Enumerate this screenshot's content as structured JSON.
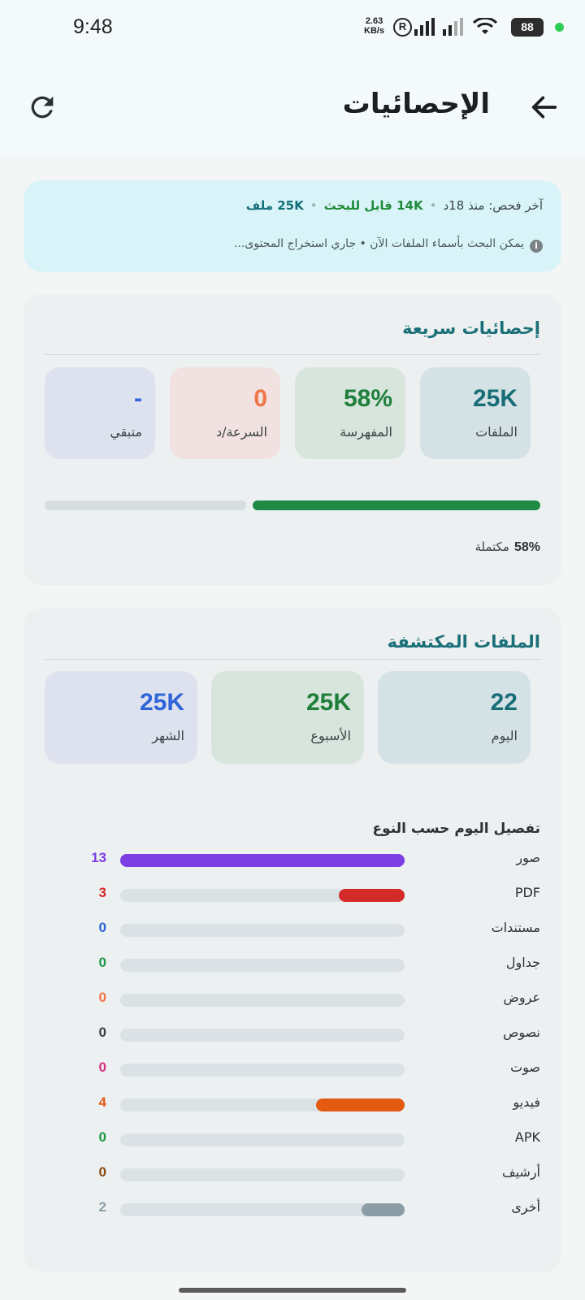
{
  "status_bar": {
    "time": "9:48",
    "net_speed_value": "2.63",
    "net_speed_unit": "KB/s",
    "battery": "88"
  },
  "header": {
    "title": "الإحصائيات"
  },
  "banner": {
    "last_scan": "آخر فحص: منذ 18د",
    "searchable": "14K قابل للبحث",
    "files": "25K ملف",
    "note": "يمكن البحث بأسماء الملفات الآن • جاري استخراج المحتوى..."
  },
  "quick_stats": {
    "title": "إحصائيات سريعة",
    "tiles": [
      {
        "value": "25K",
        "label": "الملفات",
        "color": "#176e77",
        "bg": "#d4e2e5"
      },
      {
        "value": "58%",
        "label": "المفهرسة",
        "color": "#1f7f3a",
        "bg": "#d8e5dd"
      },
      {
        "value": "0",
        "label": "السرعة/د",
        "color": "#ef7447",
        "bg": "#f1e1e0"
      },
      {
        "value": "-",
        "label": "متبقي",
        "color": "#2f65d8",
        "bg": "#dde2ee"
      }
    ],
    "progress": {
      "percent": 58,
      "percent_text": "58%",
      "suffix": "مكتملة"
    }
  },
  "discovered": {
    "title": "الملفات المكتشفة",
    "tiles": [
      {
        "value": "22",
        "label": "اليوم",
        "color": "#176e77",
        "bg": "#d4e2e5"
      },
      {
        "value": "25K",
        "label": "الأسبوع",
        "color": "#1f7f3a",
        "bg": "#d8e5dd"
      },
      {
        "value": "25K",
        "label": "الشهر",
        "color": "#2f65d8",
        "bg": "#dde2ee"
      }
    ],
    "breakdown_title": "تفصيل اليوم حسب النوع",
    "breakdown": [
      {
        "label": "صور",
        "count": "13",
        "fraction": 1.0,
        "color": "#7d3ee3"
      },
      {
        "label": "PDF",
        "count": "3",
        "fraction": 0.23,
        "color": "#d52a2a"
      },
      {
        "label": "مستندات",
        "count": "0",
        "fraction": 0,
        "color": "#2f65d8"
      },
      {
        "label": "جداول",
        "count": "0",
        "fraction": 0,
        "color": "#1f9a48"
      },
      {
        "label": "عروض",
        "count": "0",
        "fraction": 0,
        "color": "#ef7447"
      },
      {
        "label": "نصوص",
        "count": "0",
        "fraction": 0,
        "color": "#3a4246"
      },
      {
        "label": "صوت",
        "count": "0",
        "fraction": 0,
        "color": "#d63384"
      },
      {
        "label": "فيديو",
        "count": "4",
        "fraction": 0.31,
        "color": "#e35a10"
      },
      {
        "label": "APK",
        "count": "0",
        "fraction": 0,
        "color": "#1f9a48"
      },
      {
        "label": "أرشيف",
        "count": "0",
        "fraction": 0,
        "color": "#8a4a12"
      },
      {
        "label": "أخرى",
        "count": "2",
        "fraction": 0.15,
        "color": "#8c9da6"
      }
    ]
  }
}
